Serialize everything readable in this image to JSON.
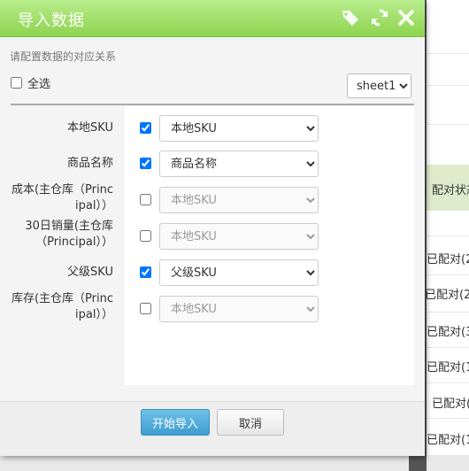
{
  "background": {
    "header_label": "配对状态",
    "cells": [
      "已配对(2",
      "已配对(2",
      "已配对(3",
      "已配对(1",
      "已配对(",
      "已配对(1"
    ]
  },
  "modal": {
    "title": "导入数据",
    "hint": "请配置数据的对应关系",
    "select_all_label": "全选",
    "sheet": {
      "selected": "sheet1",
      "options": [
        "sheet1"
      ]
    },
    "rows": [
      {
        "label_lines": [
          "本地SKU"
        ],
        "checked": true,
        "value": "本地SKU"
      },
      {
        "label_lines": [
          "商品名称"
        ],
        "checked": true,
        "value": "商品名称"
      },
      {
        "label_lines": [
          "成本(主仓库（Princ",
          "ipal））"
        ],
        "checked": false,
        "value": "本地SKU"
      },
      {
        "label_lines": [
          "30日销量(主仓库",
          "（Principal））"
        ],
        "checked": false,
        "value": "本地SKU"
      },
      {
        "label_lines": [
          "父级SKU"
        ],
        "checked": true,
        "value": "父级SKU"
      },
      {
        "label_lines": [
          "库存(主仓库（Princ",
          "ipal））"
        ],
        "checked": false,
        "value": "本地SKU"
      }
    ],
    "start_button": "开始导入",
    "cancel_button": "取消",
    "icons": [
      "tag-icon",
      "refresh-icon",
      "close-icon"
    ],
    "colors": {
      "header": "#9cdc61",
      "primary_button": "#4aa8d8"
    }
  }
}
